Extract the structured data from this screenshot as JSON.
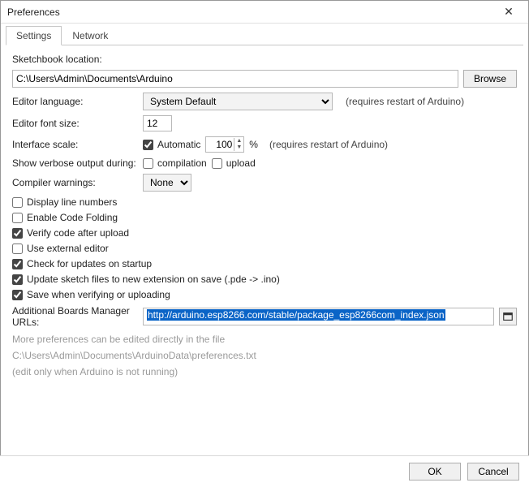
{
  "window": {
    "title": "Preferences"
  },
  "tabs": {
    "settings": "Settings",
    "network": "Network"
  },
  "labels": {
    "sketchbook": "Sketchbook location:",
    "browse": "Browse",
    "editor_language": "Editor language:",
    "requires_restart": "(requires restart of Arduino)",
    "editor_font_size": "Editor font size:",
    "interface_scale": "Interface scale:",
    "automatic": "Automatic",
    "percent": "%",
    "verbose": "Show verbose output during:",
    "compilation": "compilation",
    "upload": "upload",
    "compiler_warnings": "Compiler warnings:",
    "additional_urls": "Additional Boards Manager URLs:",
    "more_prefs": "More preferences can be edited directly in the file",
    "edit_only": "(edit only when Arduino is not running)",
    "ok": "OK",
    "cancel": "Cancel"
  },
  "values": {
    "sketchbook_path": "C:\\Users\\Admin\\Documents\\Arduino",
    "language": "System Default",
    "font_size": "12",
    "scale": "100",
    "warnings": "None",
    "boards_url": "http://arduino.esp8266.com/stable/package_esp8266com_index.json",
    "prefs_path": "C:\\Users\\Admin\\Documents\\ArduinoData\\preferences.txt"
  },
  "checkboxes": {
    "automatic": true,
    "compilation": false,
    "upload": false,
    "display_line_numbers": {
      "label": "Display line numbers",
      "checked": false
    },
    "code_folding": {
      "label": "Enable Code Folding",
      "checked": false
    },
    "verify_after_upload": {
      "label": "Verify code after upload",
      "checked": true
    },
    "external_editor": {
      "label": "Use external editor",
      "checked": false
    },
    "check_updates": {
      "label": "Check for updates on startup",
      "checked": true
    },
    "update_ext": {
      "label": "Update sketch files to new extension on save (.pde -> .ino)",
      "checked": true
    },
    "save_on_verify": {
      "label": "Save when verifying or uploading",
      "checked": true
    }
  }
}
